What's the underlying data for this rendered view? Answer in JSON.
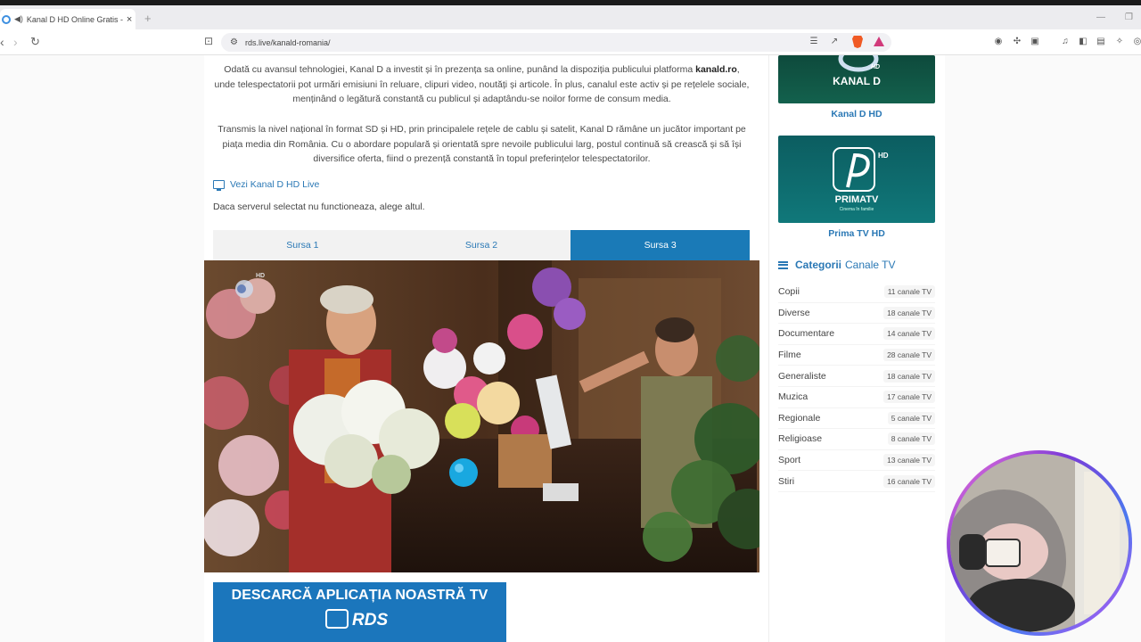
{
  "browser": {
    "tab_title": "Kanal D HD Online Gratis - RDS",
    "new_tab_symbol": "+",
    "close_symbol": "×",
    "url": "rds.live/kanald-romania/"
  },
  "article": {
    "paragraph1_a": "Odată cu avansul tehnologiei, Kanal D a investit și în prezența sa online, punând la dispoziția publicului platforma ",
    "paragraph1_bold": "kanald.ro",
    "paragraph1_b": ", unde telespectatorii pot urmări emisiuni în reluare, clipuri video, noutăți și articole. În plus, canalul este activ și pe rețelele sociale, menținând o legătură constantă cu publicul și adaptându-se noilor forme de consum media.",
    "paragraph2": "Transmis la nivel național în format SD și HD, prin principalele rețele de cablu și satelit, Kanal D rămâne un jucător important pe piața media din România. Cu o abordare populară și orientată spre nevoile publicului larg, postul continuă să crească și să își diversifice oferta, fiind o prezență constantă în topul preferințelor telespectatorilor.",
    "live_link": "Vezi Kanal D HD Live",
    "server_note": "Daca serverul selectat nu functioneaza, alege altul."
  },
  "source_tabs": [
    {
      "label": "Sursa 1",
      "active": false
    },
    {
      "label": "Sursa 2",
      "active": false
    },
    {
      "label": "Sursa 3",
      "active": true
    }
  ],
  "banner": {
    "text": "DESCARCĂ APLICAȚIA NOASTRĂ TV",
    "logo": "RDS"
  },
  "sidebar": {
    "channels": [
      {
        "name": "Kanal D HD",
        "logo_text": "KANAL D",
        "hd": "HD"
      },
      {
        "name": "Prima TV HD",
        "logo_text": "PRIMATV",
        "hd": "HD",
        "tagline": "Cinema în familie"
      }
    ],
    "categories_title_bold": "Categorii",
    "categories_title_rest": "Canale TV",
    "categories": [
      {
        "name": "Copii",
        "count": "11 canale TV"
      },
      {
        "name": "Diverse",
        "count": "18 canale TV"
      },
      {
        "name": "Documentare",
        "count": "14 canale TV"
      },
      {
        "name": "Filme",
        "count": "28 canale TV"
      },
      {
        "name": "Generaliste",
        "count": "18 canale TV"
      },
      {
        "name": "Muzica",
        "count": "17 canale TV"
      },
      {
        "name": "Regionale",
        "count": "5 canale TV"
      },
      {
        "name": "Religioase",
        "count": "8 canale TV"
      },
      {
        "name": "Sport",
        "count": "13 canale TV"
      },
      {
        "name": "Stiri",
        "count": "16 canale TV"
      }
    ]
  },
  "video": {
    "watermark": "HD"
  },
  "colors": {
    "accent": "#1a7ab7",
    "link": "#2a78b5",
    "kanald_bg": "#0f5a4a",
    "primatv_bg": "#0e6f73"
  }
}
